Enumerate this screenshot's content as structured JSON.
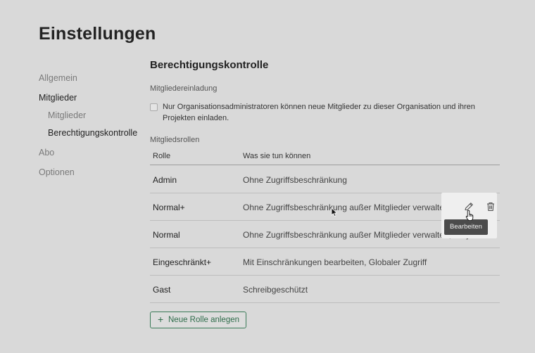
{
  "page": {
    "title": "Einstellungen"
  },
  "sidebar": {
    "items": [
      {
        "label": "Allgemein"
      },
      {
        "label": "Mitglieder"
      },
      {
        "label": "Mitglieder"
      },
      {
        "label": "Berechtigungskontrolle"
      },
      {
        "label": "Abo"
      },
      {
        "label": "Optionen"
      }
    ]
  },
  "main": {
    "title": "Berechtigungskontrolle",
    "invitation": {
      "heading": "Mitgliedereinladung",
      "checkbox_label": "Nur Organisationsadministratoren können neue Mitglieder zu dieser Organisation und ihren Projekten einladen.",
      "checked": false
    },
    "roles": {
      "heading": "Mitgliedsrollen",
      "columns": [
        "Rolle",
        "Was sie tun können"
      ],
      "rows": [
        {
          "role": "Admin",
          "description": "Ohne Zugriffsbeschränkung"
        },
        {
          "role": "Normal+",
          "description": "Ohne Zugriffsbeschränkung außer Mitglieder verwalten"
        },
        {
          "role": "Normal",
          "description": "Ohne Zugriffsbeschränkung außer Mitglieder verwalten, Projekte"
        },
        {
          "role": "Eingeschränkt+",
          "description": "Mit Einschränkungen bearbeiten, Globaler Zugriff"
        },
        {
          "role": "Gast",
          "description": "Schreibgeschützt"
        }
      ]
    },
    "add_role_label": "Neue Rolle anlegen"
  },
  "row_actions": {
    "edit_icon": "pencil-icon",
    "delete_icon": "trash-icon",
    "tooltip": "Bearbeiten"
  },
  "colors": {
    "background": "#d9d9d9",
    "accent": "#2f6d4b",
    "tooltip_bg": "#4b4b4b"
  }
}
